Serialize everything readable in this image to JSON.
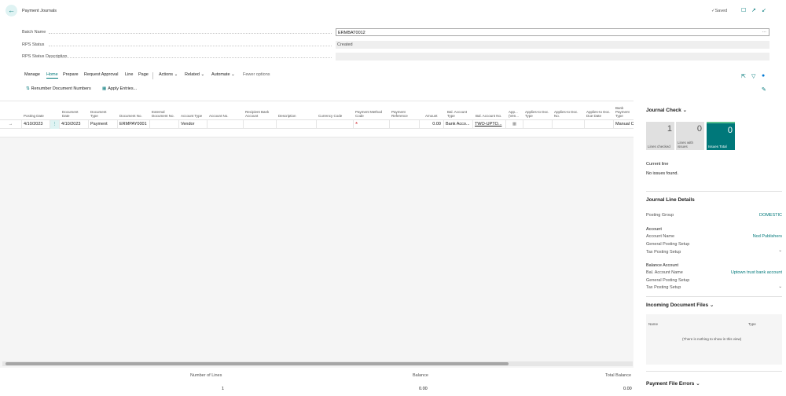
{
  "header": {
    "back_icon": "back-arrow-icon",
    "title": "Payment Journals",
    "saved_label": "Saved",
    "icons": [
      "bookmark-icon",
      "open-new-window-icon",
      "collapse-icon"
    ]
  },
  "fields": [
    {
      "label": "Batch Name",
      "value": "ERMBAT0012",
      "editable": true
    },
    {
      "label": "RPS Status",
      "value": "Created",
      "editable": false
    },
    {
      "label": "RPS Status Description",
      "value": "",
      "editable": false
    }
  ],
  "actions": {
    "manage": "Manage",
    "home": "Home",
    "prepare": "Prepare",
    "request_approval": "Request Approval",
    "line": "Line",
    "page": "Page",
    "actions": "Actions",
    "related": "Related",
    "automate": "Automate",
    "fewer_options": "Fewer options",
    "renumber": "Renumber Document Numbers",
    "apply_entries": "Apply Entries..."
  },
  "grid": {
    "columns": [
      "Posting Date",
      "Document Date",
      "Document Type",
      "Document No.",
      "External Document No.",
      "Account Type",
      "Account No.",
      "Recipient Bank Account",
      "Description",
      "Currency Code",
      "Payment Method Code",
      "Payment Reference",
      "Amount",
      "Bal. Account Type",
      "Bal. Account No.",
      "App... (Ven...",
      "Applies-to Doc. Type",
      "Applies-to Doc. No.",
      "Applies-to Doc. Due Date",
      "Bank Payment Type"
    ],
    "row": {
      "posting_date": "4/10/2023",
      "document_date": "4/10/2023",
      "document_type": "Payment",
      "document_no": "ERMPAY0001",
      "account_type": "Vendor",
      "required_marker": "*",
      "amount": "0.00",
      "bal_account_type": "Bank Acco...",
      "bal_account_no": "TWO-UPTO...",
      "bank_payment_type": "Manual C"
    }
  },
  "totals": {
    "number_of_lines_label": "Number of Lines",
    "number_of_lines": "1",
    "balance_label": "Balance",
    "balance": "0.00",
    "total_balance_label": "Total Balance",
    "total_balance": "0.00"
  },
  "factbox": {
    "journal_check_title": "Journal Check",
    "tiles": [
      {
        "value": "1",
        "label": "Lines checked"
      },
      {
        "value": "0",
        "label": "Lines with issues"
      },
      {
        "value": "0",
        "label": "Issues Total"
      }
    ],
    "current_line_label": "Current line",
    "current_line_text": "No issues found.",
    "details_title": "Journal Line Details",
    "posting_group_label": "Posting Group",
    "posting_group_value": "DOMESTIC",
    "account_heading": "Account",
    "account_name_label": "Account Name",
    "account_name_value": "Nod Publishers",
    "gen_posting_setup_label": "General Posting Setup",
    "tax_posting_setup_label": "Tax Posting Setup",
    "balance_account_heading": "Balance Account",
    "bal_account_name_label": "Bal. Account Name",
    "bal_account_name_value": "Uptown trust bank account",
    "bal_gen_posting_setup_label": "General Posting Setup",
    "bal_tax_posting_setup_label": "Tax Posting Setup",
    "incoming_docs_title": "Incoming Document Files",
    "incoming_name_col": "Name",
    "incoming_type_col": "Type",
    "incoming_empty": "(There is nothing to show in this view)",
    "payment_errors_title": "Payment File Errors"
  },
  "colors": {
    "accent": "#00787a",
    "tile_grey": "#e0e0e0",
    "required": "#d13438"
  }
}
